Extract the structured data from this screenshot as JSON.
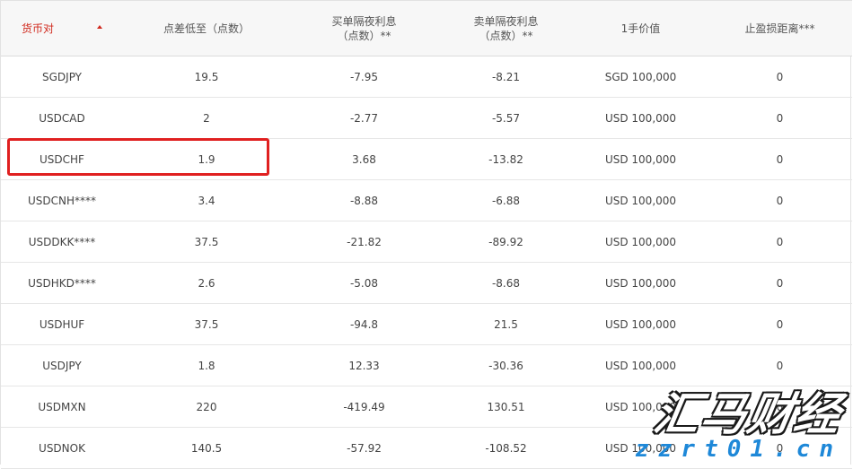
{
  "table": {
    "columns": [
      {
        "label": "货币对",
        "sub": ""
      },
      {
        "label": "点差低至（点数）",
        "sub": ""
      },
      {
        "label": "买单隔夜利息",
        "sub": "（点数）**"
      },
      {
        "label": "卖单隔夜利息",
        "sub": "（点数）**"
      },
      {
        "label": "1手价值",
        "sub": ""
      },
      {
        "label": "止盈损距离***",
        "sub": ""
      }
    ],
    "sorted_column": 0,
    "rows": [
      [
        "SGDJPY",
        "19.5",
        "-7.95",
        "-8.21",
        "SGD 100,000",
        "0"
      ],
      [
        "USDCAD",
        "2",
        "-2.77",
        "-5.57",
        "USD 100,000",
        "0"
      ],
      [
        "USDCHF",
        "1.9",
        "3.68",
        "-13.82",
        "USD 100,000",
        "0"
      ],
      [
        "USDCNH****",
        "3.4",
        "-8.88",
        "-6.88",
        "USD 100,000",
        "0"
      ],
      [
        "USDDKK****",
        "37.5",
        "-21.82",
        "-89.92",
        "USD 100,000",
        "0"
      ],
      [
        "USDHKD****",
        "2.6",
        "-5.08",
        "-8.68",
        "USD 100,000",
        "0"
      ],
      [
        "USDHUF",
        "37.5",
        "-94.8",
        "21.5",
        "USD 100,000",
        "0"
      ],
      [
        "USDJPY",
        "1.8",
        "12.33",
        "-30.36",
        "USD 100,000",
        "0"
      ],
      [
        "USDMXN",
        "220",
        "-419.49",
        "130.51",
        "USD 100,000",
        "0"
      ],
      [
        "USDNOK",
        "140.5",
        "-57.92",
        "-108.52",
        "USD 100,000",
        "0"
      ]
    ]
  },
  "highlighted_row": 2,
  "watermark": {
    "title": "汇马财经",
    "domain": "zzrt01.cn"
  },
  "colors": {
    "accent": "#d0281c",
    "highlight": "#e02020",
    "watermark_blue": "#1e88d8"
  }
}
